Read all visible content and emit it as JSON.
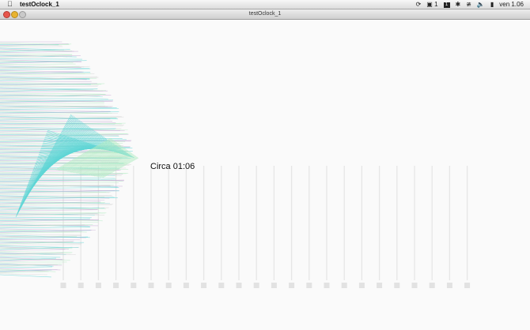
{
  "menubar": {
    "apple_icon": "apple-icon",
    "app_name": "testOclock_1",
    "status_text_1": "1",
    "datetime": "ven 1.06",
    "icons": [
      "time-machine-icon",
      "monitor-icon",
      "black-square-icon",
      "bluetooth-icon",
      "wifi-icon",
      "volume-icon",
      "battery-icon"
    ]
  },
  "window": {
    "title": "testOclock_1"
  },
  "sketch": {
    "clock_label": "Circa 01:06",
    "column_count": 24,
    "colors": {
      "cyan": "#5fd6d6",
      "lilac": "#c7a9d6",
      "mint": "#b4ecc4",
      "grey": "#d6d6d6"
    }
  }
}
